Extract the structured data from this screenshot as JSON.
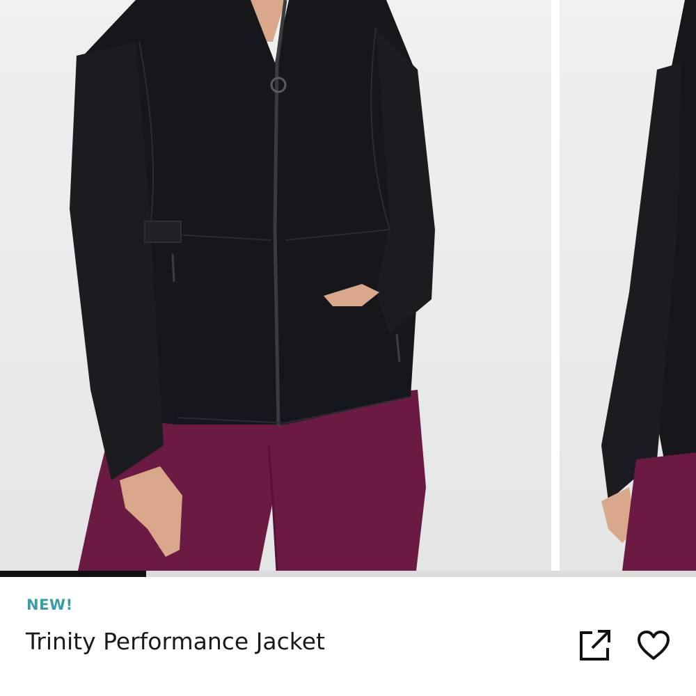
{
  "product": {
    "badge": "NEW!",
    "title": "Trinity Performance Jacket"
  },
  "gallery": {
    "image_count": 2,
    "progress_fraction": 0.21,
    "images": [
      {
        "subject": "front view of black zip-up jacket with plum leggings"
      },
      {
        "subject": "side view of black jacket"
      }
    ]
  },
  "actions": {
    "share_icon": "share-external-icon",
    "favorite_icon": "heart-outline-icon"
  },
  "colors": {
    "badge": "#3a9ea8",
    "jacket": "#16171a",
    "leggings": "#6b1a44",
    "progress_fill": "#111111",
    "progress_track": "#dcdcdc"
  }
}
